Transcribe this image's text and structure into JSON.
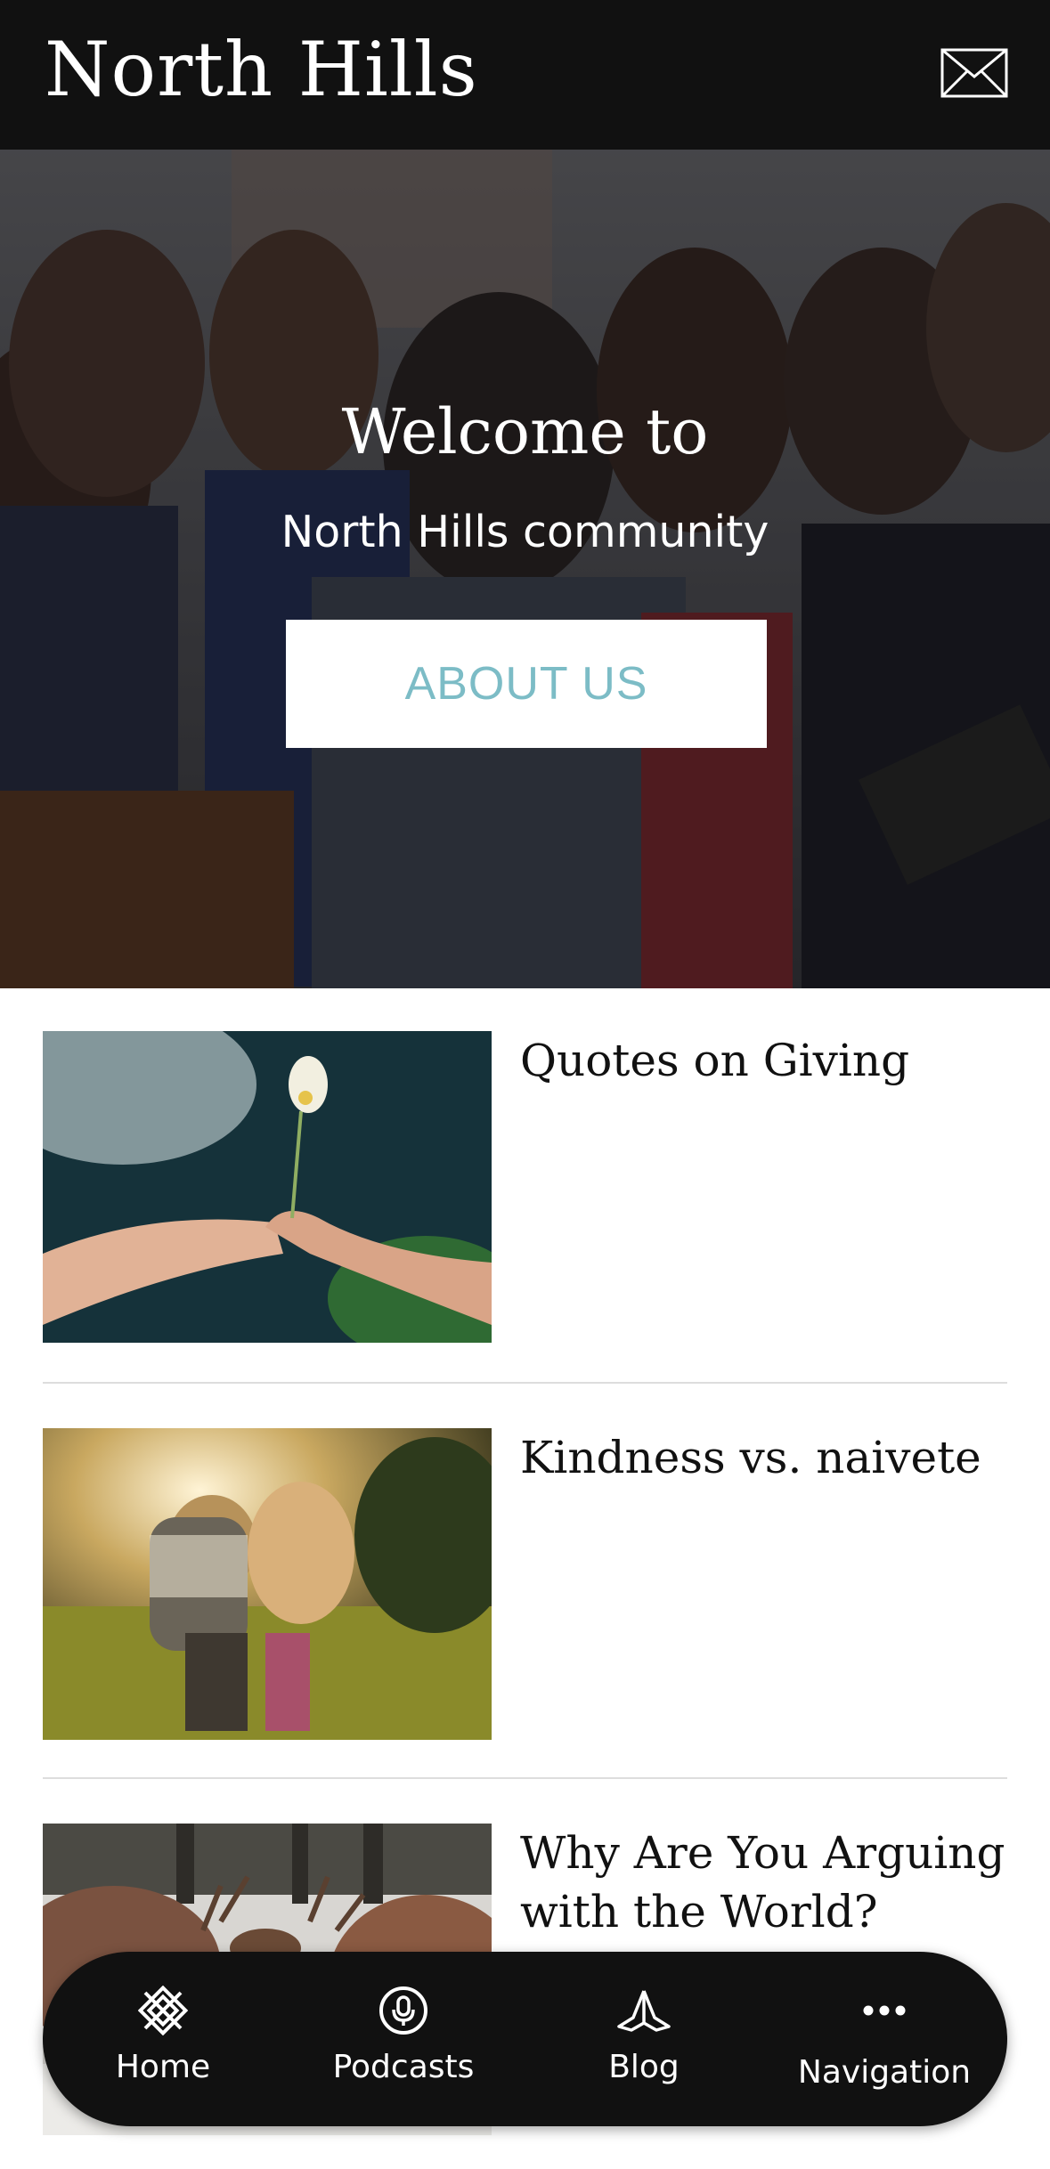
{
  "header": {
    "title": "North Hills",
    "mail_icon": "mail-icon"
  },
  "hero": {
    "heading": "Welcome to",
    "subheading": "North Hills community",
    "button_label": "ABOUT US"
  },
  "posts": [
    {
      "title": "Quotes on Giving",
      "image": "hands-giving-flower"
    },
    {
      "title": "Kindness vs. naivete",
      "image": "child-carrying-child"
    },
    {
      "title": "Why Are You Arguing with the World?",
      "image": "deer-fighting"
    }
  ],
  "bottom_nav": {
    "items": [
      {
        "label": "Home",
        "icon": "home-knot-icon"
      },
      {
        "label": "Podcasts",
        "icon": "microphone-icon"
      },
      {
        "label": "Blog",
        "icon": "praying-hands-icon"
      },
      {
        "label": "Navigation",
        "icon": "more-dots-icon"
      }
    ]
  },
  "colors": {
    "header_bg": "#111111",
    "button_text": "#7cbcc6",
    "nav_bg": "#111111"
  }
}
